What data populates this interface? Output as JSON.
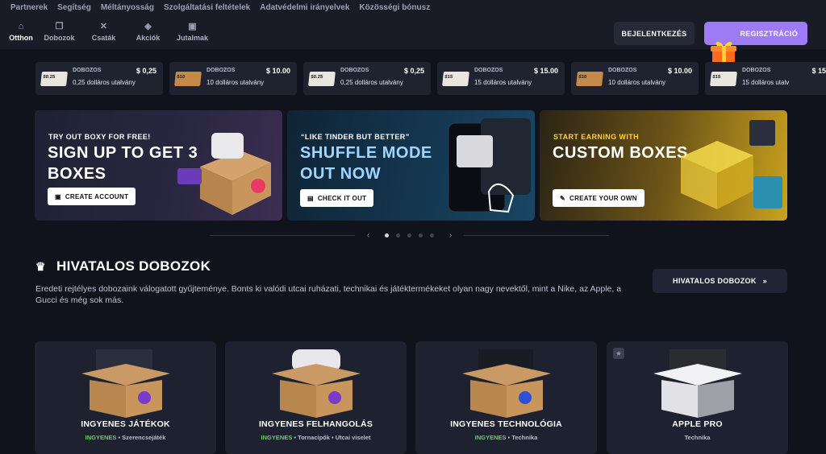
{
  "topbar": {
    "links": [
      "Partnerek",
      "Segítség",
      "Méltányosság",
      "Szolgáltatási feltételek",
      "Adatvédelmi irányelvek",
      "Közösségi bónusz"
    ]
  },
  "nav": {
    "items": [
      {
        "label": "Otthon",
        "icon": "home-icon",
        "active": true
      },
      {
        "label": "Dobozok",
        "icon": "box-icon",
        "active": false
      },
      {
        "label": "Csaták",
        "icon": "swords-icon",
        "active": false
      },
      {
        "label": "Akciók",
        "icon": "tag-icon",
        "active": false
      },
      {
        "label": "Jutalmak",
        "icon": "gift-icon",
        "active": false
      }
    ],
    "login_label": "BEJELENTKEZÉS",
    "register_label": "REGISZTRÁCIÓ"
  },
  "ticker": [
    {
      "category": "DOBOZOS",
      "price": "$ 0,25",
      "name": "0,25 dolláros utalvány",
      "thumb": "$0.25"
    },
    {
      "category": "DOBOZOS",
      "price": "$ 10.00",
      "name": "10 dolláros utalvány",
      "thumb": "$10"
    },
    {
      "category": "DOBOZOS",
      "price": "$ 0,25",
      "name": "0,25 dolláros utalvány",
      "thumb": "$0.25"
    },
    {
      "category": "DOBOZOS",
      "price": "$ 15.00",
      "name": "15 dolláros utalvány",
      "thumb": "$15"
    },
    {
      "category": "DOBOZOS",
      "price": "$ 10.00",
      "name": "10 dolláros utalvány",
      "thumb": "$10"
    },
    {
      "category": "DOBOZOS",
      "price": "$ 15",
      "name": "15 dolláros utalv",
      "thumb": "$15"
    }
  ],
  "banners": [
    {
      "small": "TRY OUT BOXY FOR FREE!",
      "big": "SIGN UP TO GET 3 BOXES",
      "button": "CREATE ACCOUNT",
      "small_color": "#ffffff"
    },
    {
      "small": "“LIKE TINDER BUT BETTER”",
      "big": "SHUFFLE MODE OUT NOW",
      "button": "CHECK IT OUT",
      "small_color": "#ffffff"
    },
    {
      "small": "START EARNING WITH",
      "big": "CUSTOM BOXES",
      "button": "CREATE YOUR OWN",
      "small_color": "#ffd23c"
    }
  ],
  "carousel": {
    "active_index": 0,
    "count": 5
  },
  "official": {
    "title": "HIVATALOS DOBOZOK",
    "description": "Eredeti rejtélyes dobozaink válogatott gyűjteménye. Bonts ki valódi utcai ruházati, technikai és játéktermékeket olyan nagy nevektől, mint a Nike, az Apple, a Gucci és még sok más.",
    "button": "HIVATALOS DOBOZOK"
  },
  "cards": [
    {
      "title": "INGYENES JÁTÉKOK",
      "free": "INGYENES",
      "tags": "Szerencsejáték"
    },
    {
      "title": "INGYENES FELHANGOLÁS",
      "free": "INGYENES",
      "tags": "Tornacipők  •  Utcai viselet"
    },
    {
      "title": "INGYENES TECHNOLÓGIA",
      "free": "INGYENES",
      "tags": "Technika"
    },
    {
      "title": "APPLE PRO",
      "free": "",
      "tags": "Technika"
    }
  ]
}
